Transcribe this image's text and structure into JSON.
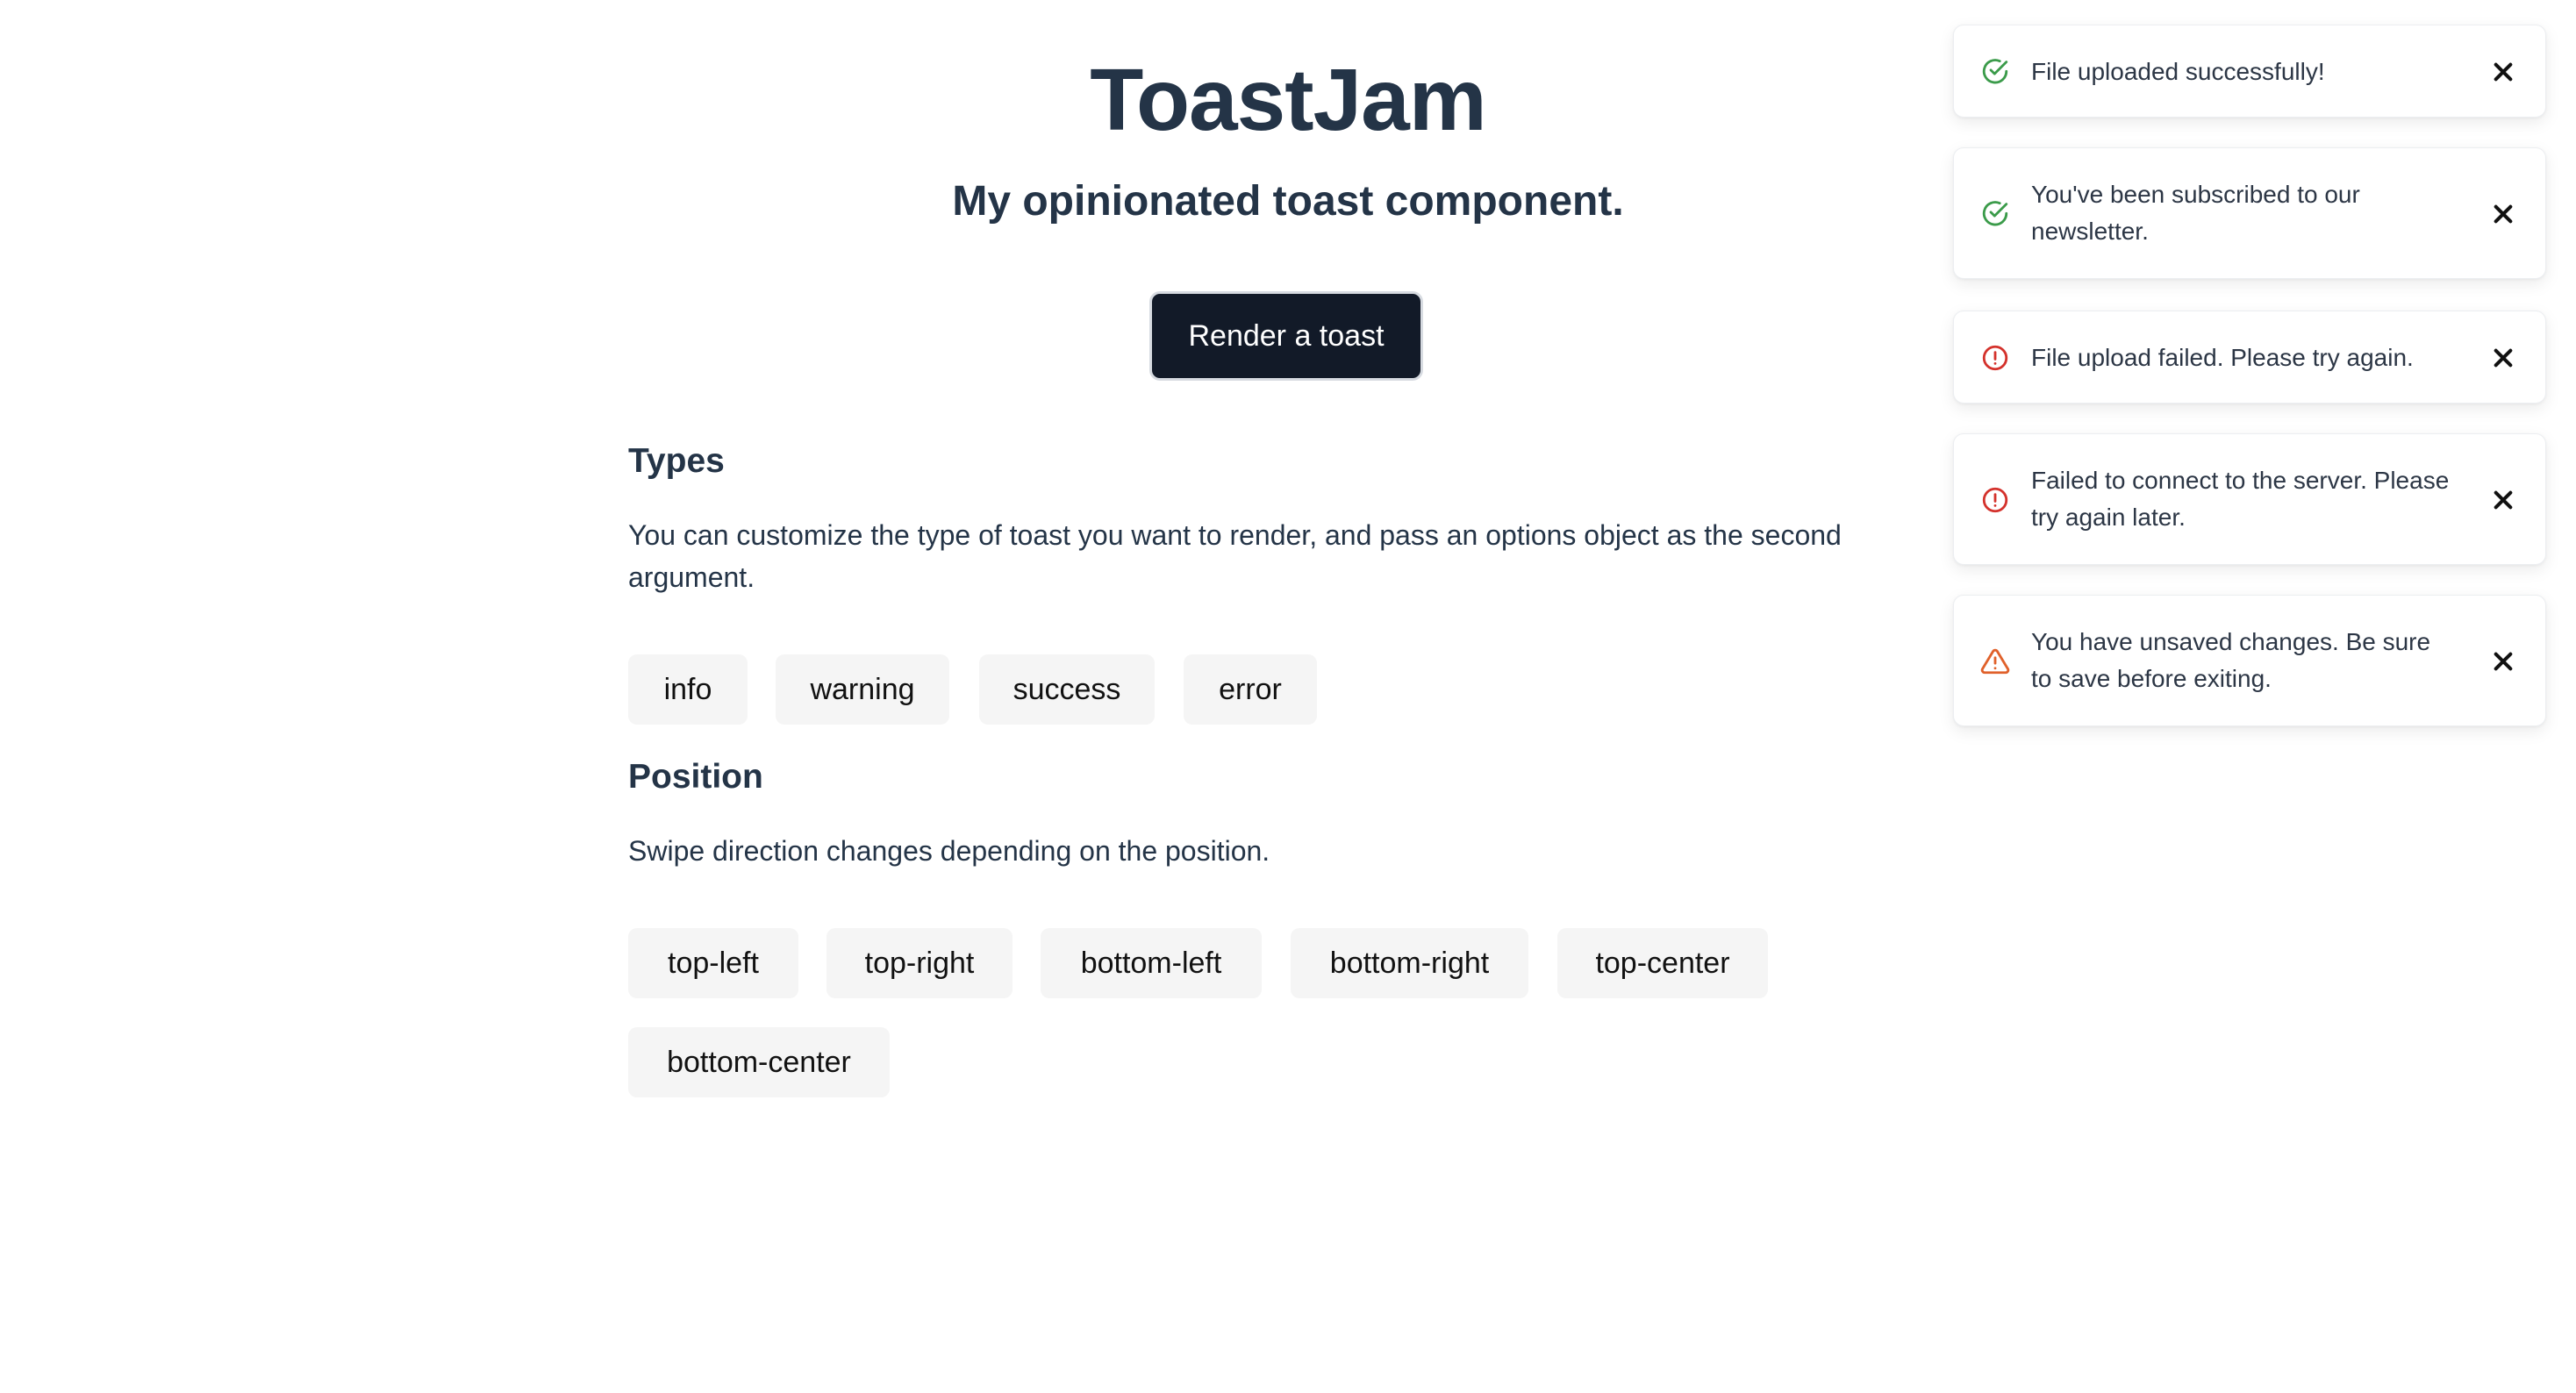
{
  "header": {
    "title": "ToastJam",
    "subtitle": "My opinionated toast component.",
    "render_button_label": "Render a toast"
  },
  "types_section": {
    "heading": "Types",
    "description": "You can customize the type of toast you want to render, and pass an options object as the second argument.",
    "buttons": [
      "info",
      "warning",
      "success",
      "error"
    ]
  },
  "position_section": {
    "heading": "Position",
    "description": "Swipe direction changes depending on the position.",
    "buttons": [
      "top-left",
      "top-right",
      "bottom-left",
      "bottom-right",
      "top-center",
      "bottom-center"
    ]
  },
  "toasts": [
    {
      "type": "success",
      "icon": "check-circle-icon",
      "message": "File uploaded successfully!"
    },
    {
      "type": "success",
      "icon": "check-circle-icon",
      "message": "You've been subscribed to our newsletter."
    },
    {
      "type": "error",
      "icon": "alert-circle-icon",
      "message": "File upload failed. Please try again."
    },
    {
      "type": "error",
      "icon": "alert-circle-icon",
      "message": "Failed to connect to the server. Please try again later."
    },
    {
      "type": "warning",
      "icon": "warning-triangle-icon",
      "message": "You have unsaved changes. Be sure to save before exiting."
    }
  ],
  "colors": {
    "success": "#3b9b4a",
    "error": "#d4322c",
    "warning": "#e0612b",
    "button_dark": "#121a28",
    "chip_bg": "#f5f5f5",
    "text": "#243447"
  }
}
